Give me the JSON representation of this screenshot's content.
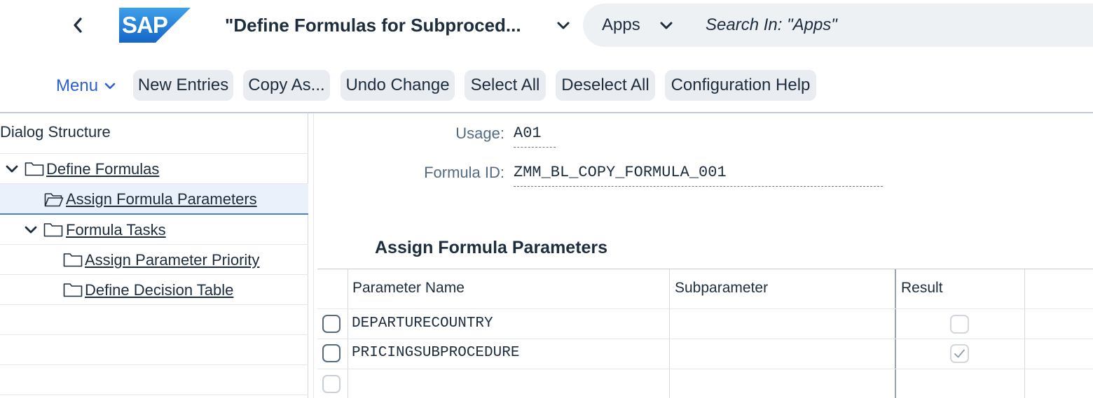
{
  "shell": {
    "brand": "SAP",
    "title": "\"Define Formulas for Subproced...",
    "search_scope": "Apps",
    "search_placeholder": "Search In: \"Apps\""
  },
  "toolbar": {
    "menu_label": "Menu",
    "buttons": [
      "New Entries",
      "Copy As...",
      "Undo Change",
      "Select All",
      "Deselect All",
      "Configuration Help"
    ]
  },
  "dialog_structure": {
    "title": "Dialog Structure",
    "items": [
      {
        "label": "Define Formulas",
        "expanded": true,
        "level": 0
      },
      {
        "label": "Assign Formula Parameters",
        "selected": true,
        "level": 1
      },
      {
        "label": "Formula Tasks",
        "expanded": true,
        "level": 1
      },
      {
        "label": "Assign Parameter Priority",
        "level": 2
      },
      {
        "label": "Define Decision Table",
        "level": 2
      }
    ]
  },
  "header": {
    "usage_label": "Usage:",
    "usage_value": "A01",
    "formula_label": "Formula ID:",
    "formula_value": "ZMM_BL_COPY_FORMULA_001"
  },
  "section": {
    "title": "Assign Formula Parameters",
    "columns": [
      "Parameter Name",
      "Subparameter",
      "Result"
    ],
    "rows": [
      {
        "parameter": "DEPARTURECOUNTRY",
        "subparameter": "",
        "result": false
      },
      {
        "parameter": "PRICINGSUBPROCEDURE",
        "subparameter": "",
        "result": true
      },
      {
        "parameter": "",
        "subparameter": "",
        "result": null
      }
    ]
  },
  "colors": {
    "accent": "#2d5fd4",
    "brand_blue": "#1f73d0",
    "text": "#1d2d3e",
    "button_bg": "#e9ecf0"
  }
}
